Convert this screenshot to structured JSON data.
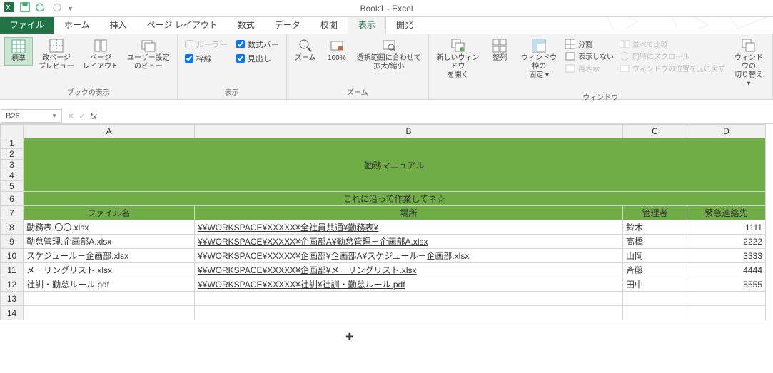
{
  "app": {
    "title": "Book1 - Excel"
  },
  "qat": {
    "undo_aria": "undo",
    "redo_aria": "redo"
  },
  "tabs": {
    "file": "ファイル",
    "items": [
      "ホーム",
      "挿入",
      "ページ レイアウト",
      "数式",
      "データ",
      "校閲",
      "表示",
      "開発"
    ],
    "active_index": 6
  },
  "ribbon": {
    "views": {
      "label": "ブックの表示",
      "normal": "標準",
      "page_break": "改ページ\nプレビュー",
      "page_layout": "ページ\nレイアウト",
      "custom": "ユーザー設定\nのビュー"
    },
    "show": {
      "label": "表示",
      "ruler": "ルーラー",
      "formula_bar": "数式バー",
      "gridlines": "枠線",
      "headings": "見出し"
    },
    "zoom": {
      "label": "ズーム",
      "zoom": "ズーム",
      "hundred": "100%",
      "selection": "選択範囲に合わせて\n拡大/縮小"
    },
    "window": {
      "label": "ウィンドウ",
      "new_win": "新しいウィンドウ\nを開く",
      "arrange": "整列",
      "freeze": "ウィンドウ枠の\n固定 ▾",
      "split": "分割",
      "hide": "表示しない",
      "unhide": "再表示",
      "side_by_side": "並べて比較",
      "sync_scroll": "同時にスクロール",
      "reset_pos": "ウィンドウの位置を元に戻す",
      "switch": "ウィンドウの\n切り替え ▾"
    }
  },
  "formula_bar": {
    "cell_ref": "B26",
    "fx": "fx",
    "value": ""
  },
  "columns": [
    "A",
    "B",
    "C",
    "D"
  ],
  "sheet": {
    "title": "勤務マニュアル",
    "subtitle": "これに沿って作業してネ☆",
    "headers": {
      "file": "ファイル名",
      "location": "場所",
      "manager": "管理者",
      "contact": "緊急連絡先"
    },
    "rows": [
      {
        "file": "勤務表.〇〇.xlsx",
        "location": "¥¥WORKSPACE¥XXXXX¥全社員共通¥勤務表¥",
        "manager": "鈴木",
        "contact": "1111"
      },
      {
        "file": "勤怠管理.企画部A.xlsx",
        "location": "¥¥WORKSPACE¥XXXXX¥企画部A¥勤怠管理－企画部A.xlsx",
        "manager": "高橋",
        "contact": "2222"
      },
      {
        "file": "スケジュール－企画部.xlsx",
        "location": "¥¥WORKSPACE¥XXXXX¥企画部¥企画部A¥スケジュール－企画部.xlsx",
        "manager": "山岡",
        "contact": "3333"
      },
      {
        "file": "メーリングリスト.xlsx",
        "location": "¥¥WORKSPACE¥XXXXX¥企画部¥メーリングリスト.xlsx",
        "manager": "斉藤",
        "contact": "4444"
      },
      {
        "file": "社訓・勤怠ルール.pdf",
        "location": "¥¥WORKSPACE¥XXXXX¥社訓¥社訓・勤怠ルール.pdf",
        "manager": "田中",
        "contact": "5555"
      }
    ]
  }
}
